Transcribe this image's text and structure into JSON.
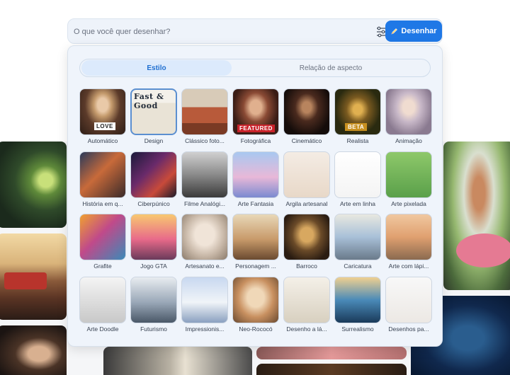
{
  "search": {
    "placeholder": "O que você quer desenhar?",
    "value": "",
    "button_label": "Desenhar"
  },
  "tabs": [
    {
      "label": "Estilo",
      "active": true
    },
    {
      "label": "Relação de aspecto",
      "active": false
    }
  ],
  "styles": [
    {
      "label": "Automático",
      "selected": false
    },
    {
      "label": "Design",
      "selected": true,
      "thumb_text": "Fast & Good"
    },
    {
      "label": "Clássico foto...",
      "selected": false
    },
    {
      "label": "Fotográfica",
      "selected": false,
      "thumb_text": "FEATURED"
    },
    {
      "label": "Cinemático",
      "selected": false
    },
    {
      "label": "Realista",
      "selected": false,
      "thumb_text": "BETA"
    },
    {
      "label": "Animação",
      "selected": false
    },
    {
      "label": "História em q...",
      "selected": false
    },
    {
      "label": "Ciberpúnico",
      "selected": false
    },
    {
      "label": "Filme Analógi...",
      "selected": false
    },
    {
      "label": "Arte Fantasia",
      "selected": false
    },
    {
      "label": "Argila artesanal",
      "selected": false
    },
    {
      "label": "Arte em linha",
      "selected": false
    },
    {
      "label": "Arte pixelada",
      "selected": false
    },
    {
      "label": "Grafite",
      "selected": false
    },
    {
      "label": "Jogo GTA",
      "selected": false
    },
    {
      "label": "Artesanato e...",
      "selected": false
    },
    {
      "label": "Personagem ...",
      "selected": false
    },
    {
      "label": "Barroco",
      "selected": false
    },
    {
      "label": "Caricatura",
      "selected": false
    },
    {
      "label": "Arte com lápi...",
      "selected": false
    },
    {
      "label": "Arte Doodle",
      "selected": false
    },
    {
      "label": "Futurismo",
      "selected": false
    },
    {
      "label": "Impressionis...",
      "selected": false
    },
    {
      "label": "Neo-Rococó",
      "selected": false
    },
    {
      "label": "Desenho a lá...",
      "selected": false
    },
    {
      "label": "Surrealismo",
      "selected": false
    },
    {
      "label": "Desenhos pa...",
      "selected": false
    }
  ],
  "thumb_texts": {
    "automatico": "LOVE"
  },
  "colors": {
    "accent": "#1f78e6",
    "active_tab_text": "#1f6fd1",
    "panel_bg": "#eff4fb"
  }
}
